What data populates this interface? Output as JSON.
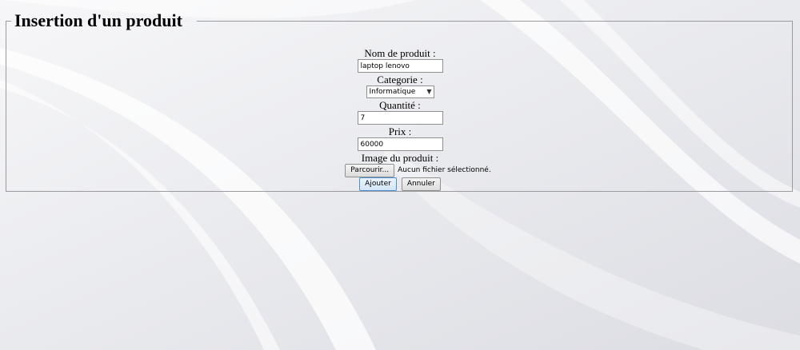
{
  "form": {
    "title": "Insertion d'un produit",
    "fields": {
      "name": {
        "label": "Nom de produit :",
        "value": "laptop lenovo"
      },
      "category": {
        "label": "Categorie :",
        "selected": "Informatique"
      },
      "quantity": {
        "label": "Quantité :",
        "value": "7"
      },
      "price": {
        "label": "Prix :",
        "value": "60000"
      },
      "image": {
        "label": "Image du produit :",
        "browse_label": "Parcourir...",
        "status": "Aucun fichier sélectionné."
      }
    },
    "actions": {
      "submit_label": "Ajouter",
      "cancel_label": "Annuler"
    }
  },
  "colors": {
    "background": "#e6e7ec",
    "fieldset_border": "#9a9aa0",
    "primary_button_border": "#4f8fd1"
  }
}
